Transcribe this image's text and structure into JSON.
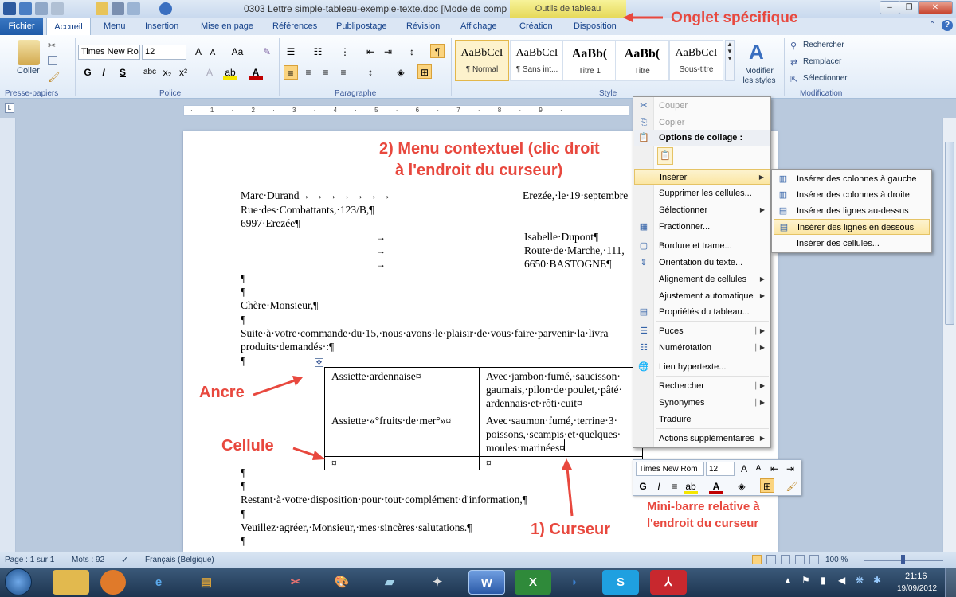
{
  "window": {
    "title": "0303 Lettre simple-tableau-exemple-texte.doc [Mode de comp...",
    "context_tab_group": "Outils de tableau",
    "controls": [
      "–",
      "❐",
      "✕"
    ]
  },
  "ribbon": {
    "tabs": [
      "Fichier",
      "Accueil",
      "Menu",
      "Insertion",
      "Mise en page",
      "Références",
      "Publipostage",
      "Révision",
      "Affichage",
      "Création",
      "Disposition"
    ],
    "clipboard": {
      "paste": "Coller",
      "label": "Presse-papiers"
    },
    "font": {
      "name": "Times New Ro",
      "size": "12",
      "label": "Police",
      "bold": "G",
      "italic": "I",
      "underline": "S",
      "strike": "abc",
      "sub": "x₂",
      "sup": "x²"
    },
    "paragraph": {
      "label": "Paragraphe"
    },
    "styles": {
      "label": "Style",
      "items": [
        {
          "preview": "AaBbCcI",
          "name": "¶ Normal"
        },
        {
          "preview": "AaBbCcI",
          "name": "¶ Sans int..."
        },
        {
          "preview": "AaBb(",
          "name": "Titre 1"
        },
        {
          "preview": "AaBb(",
          "name": "Titre"
        },
        {
          "preview": "AaBbCcI",
          "name": "Sous-titre"
        }
      ],
      "modify": "Modifier les styles"
    },
    "editing": {
      "label": "Modification",
      "find": "Rechercher",
      "replace": "Remplacer",
      "select": "Sélectionner"
    }
  },
  "document": {
    "sender_name": "Marc·Durand→ → → → → → → ",
    "date": "Erezée,·le·19·septembre",
    "sender_street": "Rue·des·Combattants,·123/B,¶",
    "sender_city": "6997·Erezée¶",
    "recipient_name": "Isabelle·Dupont¶",
    "recipient_street": "Route·de·Marche,·111,",
    "recipient_city": "6650·BASTOGNE¶",
    "pilcrow": "¶",
    "salutation": "Chère·Monsieur,¶",
    "body_line1": "Suite·à·votre·commande·du·15,·nous·avons·le·plaisir·de·vous·faire·parvenir·la·livra",
    "body_line2": "produits·demandés·:¶",
    "table": [
      [
        "Assiette·ardennaise¤",
        "Avec·jambon·fumé,·saucisson·\ngaumais,·pilon·de·poulet,·pâté·\nardennais·et·rôti·cuit¤"
      ],
      [
        "Assiette·«°fruits·de·mer°»¤",
        "Avec·saumon·fumé,·terrine·3·\npoissons,·scampis·et·quelques·\nmoules·marinées¤"
      ],
      [
        "¤",
        "¤"
      ]
    ],
    "closing1": "Restant·à·votre·disposition·pour·tout·complément·d'information,¶",
    "closing2": "Veuillez·agréer,·Monsieur,·mes·sincères·salutations.¶"
  },
  "annotations": {
    "onglet": "Onglet spécifique",
    "menu1": "2) Menu contextuel (clic droit",
    "menu2": "à l'endroit du curseur)",
    "ancre": "Ancre",
    "cellule": "Cellule",
    "curseur": "1) Curseur",
    "mini1": "Mini-barre relative à",
    "mini2": "l'endroit du curseur"
  },
  "context_menu": {
    "items": [
      {
        "label": "Couper",
        "icon": "scissors-icon",
        "disabled": true
      },
      {
        "label": "Copier",
        "icon": "copy-icon",
        "disabled": true
      },
      {
        "label": "Options de collage :",
        "icon": "paste-icon",
        "header": true
      },
      {
        "label": "Insérer",
        "submenu": true,
        "highlight": true
      },
      {
        "label": "Supprimer les cellules..."
      },
      {
        "label": "Sélectionner",
        "submenu": true
      },
      {
        "label": "Fractionner...",
        "icon": "split-cells-icon"
      },
      {
        "label": "Bordure et trame...",
        "icon": "borders-icon"
      },
      {
        "label": "Orientation du texte...",
        "icon": "text-direction-icon"
      },
      {
        "label": "Alignement de cellules",
        "submenu": true
      },
      {
        "label": "Ajustement automatique",
        "submenu": true
      },
      {
        "label": "Propriétés du tableau...",
        "icon": "table-properties-icon"
      },
      {
        "label": "Puces",
        "icon": "bullets-icon",
        "submenu": true
      },
      {
        "label": "Numérotation",
        "icon": "numbering-icon",
        "submenu": true
      },
      {
        "label": "Lien hypertexte...",
        "icon": "hyperlink-icon"
      },
      {
        "label": "Rechercher",
        "submenu": true
      },
      {
        "label": "Synonymes",
        "submenu": true
      },
      {
        "label": "Traduire"
      },
      {
        "label": "Actions supplémentaires",
        "submenu": true
      }
    ]
  },
  "submenu": {
    "items": [
      {
        "label": "Insérer des colonnes à gauche"
      },
      {
        "label": "Insérer des colonnes à droite"
      },
      {
        "label": "Insérer des lignes au-dessus"
      },
      {
        "label": "Insérer des lignes en dessous",
        "highlight": true
      },
      {
        "label": "Insérer des cellules..."
      }
    ]
  },
  "minibar": {
    "font": "Times New Rom",
    "size": "12"
  },
  "status": {
    "page": "Page : 1 sur 1",
    "words": "Mots : 92",
    "language": "Français (Belgique)",
    "zoom": "100 %"
  },
  "taskbar": {
    "time": "21:16",
    "date": "19/09/2012"
  },
  "colors": {
    "accent_red": "#e8483e",
    "ribbon_blue": "#1e5aa8",
    "highlight": "#fbe6a3"
  }
}
